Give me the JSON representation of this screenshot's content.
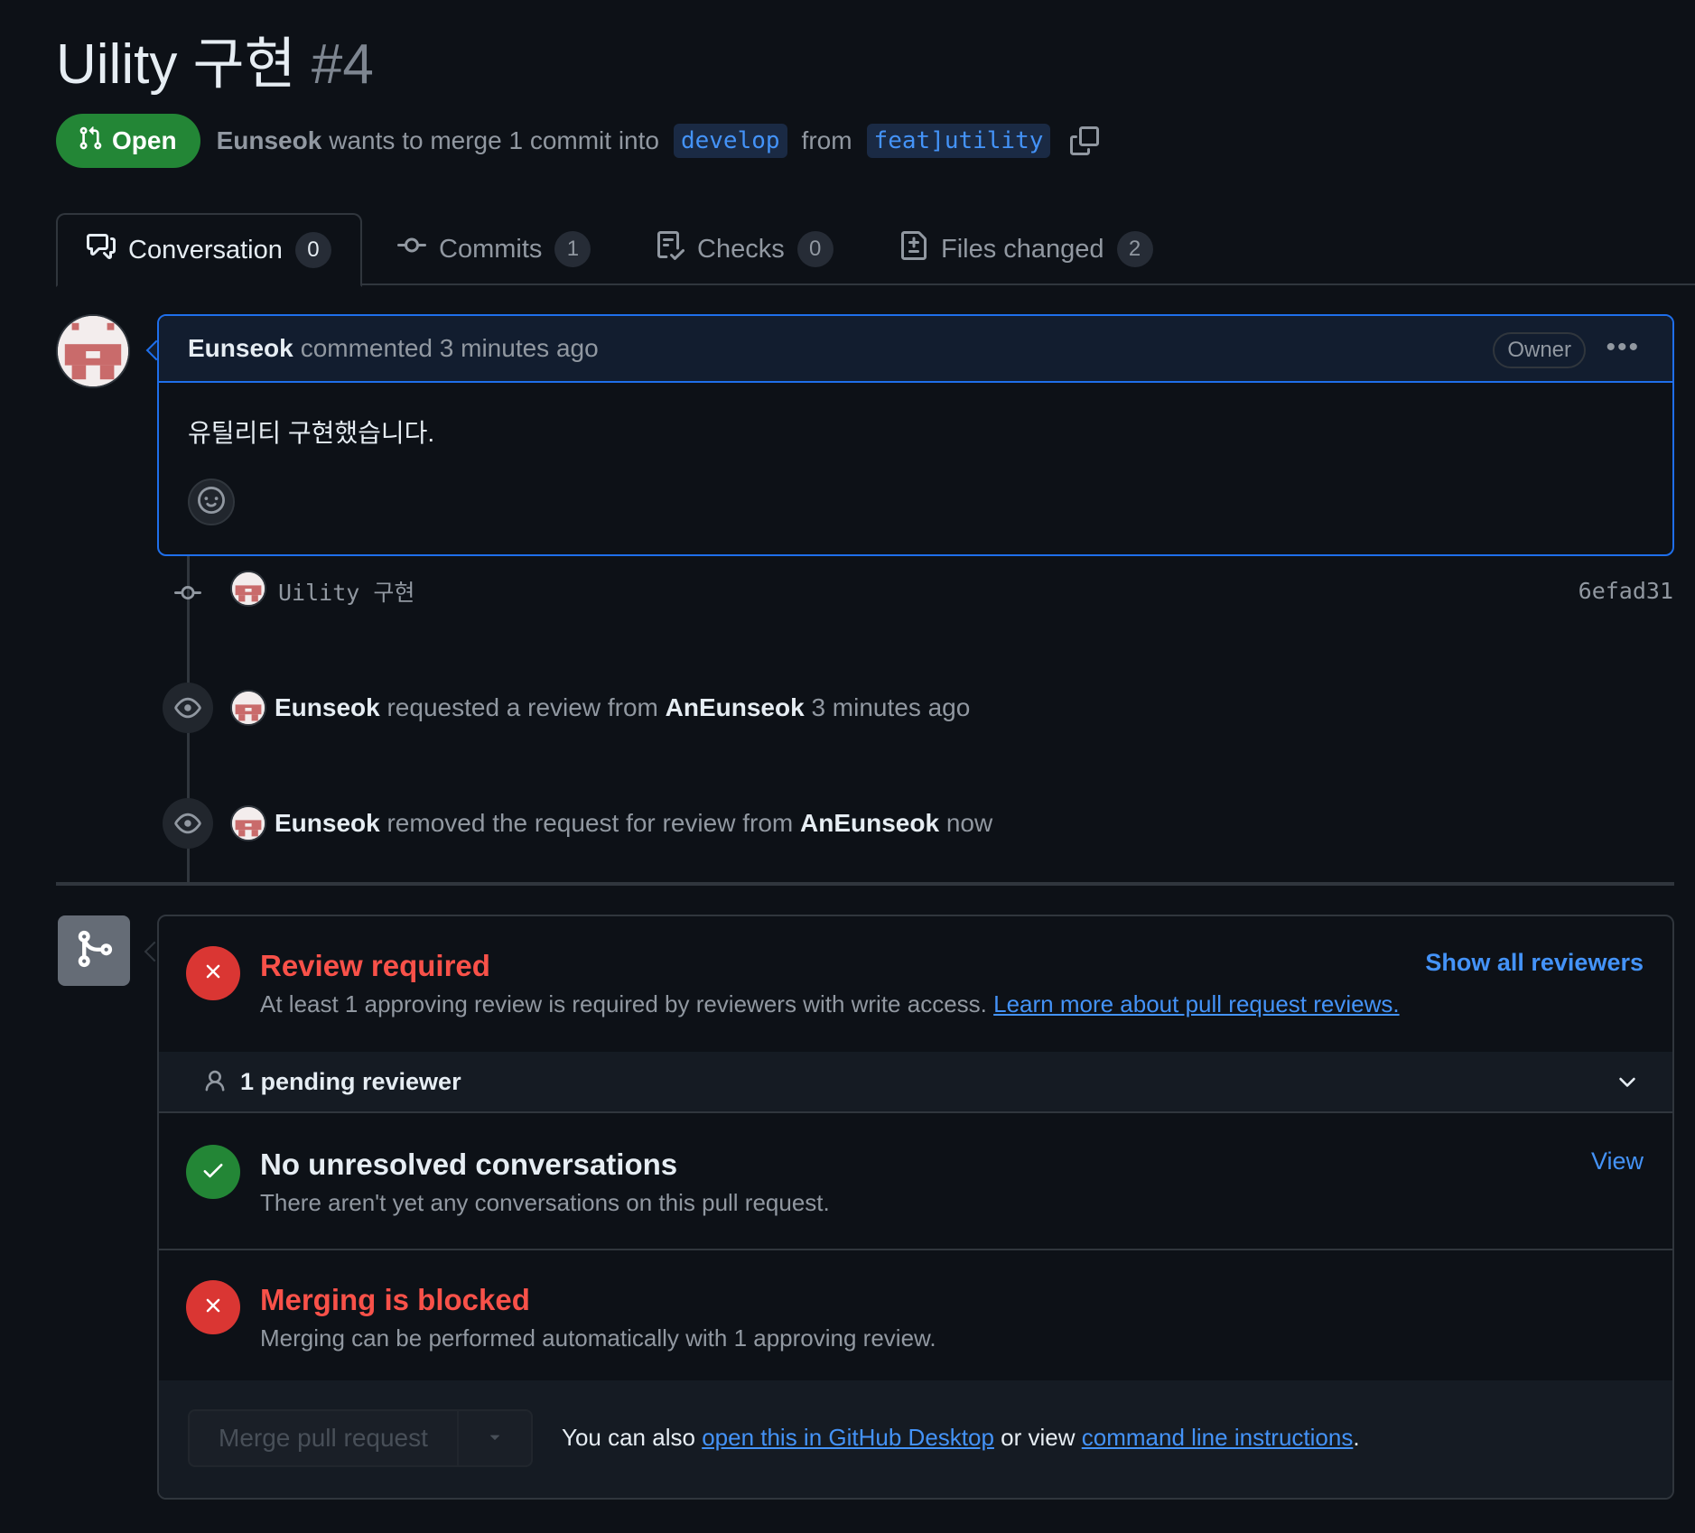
{
  "header": {
    "title": "Uility 구현",
    "number": "#4",
    "state": "Open",
    "author": "Eunseok",
    "merge_text": "wants to merge 1 commit into",
    "base_branch": "develop",
    "from_text": "from",
    "head_branch": "feat]utility"
  },
  "tabs": [
    {
      "label": "Conversation",
      "count": "0"
    },
    {
      "label": "Commits",
      "count": "1"
    },
    {
      "label": "Checks",
      "count": "0"
    },
    {
      "label": "Files changed",
      "count": "2"
    }
  ],
  "comment": {
    "author": "Eunseok",
    "action": "commented 3 minutes ago",
    "badge": "Owner",
    "body": "유틸리티 구현했습니다."
  },
  "timeline": {
    "commit": {
      "message": "Uility 구현",
      "sha": "6efad31"
    },
    "events": [
      {
        "actor": "Eunseok",
        "text": "requested a review from",
        "target": "AnEunseok",
        "time": "3 minutes ago"
      },
      {
        "actor": "Eunseok",
        "text": "removed the request for review from",
        "target": "AnEunseok",
        "time": "now"
      }
    ]
  },
  "merge_box": {
    "review": {
      "title": "Review required",
      "desc": "At least 1 approving review is required by reviewers with write access.",
      "link": "Learn more about pull request reviews.",
      "action": "Show all reviewers"
    },
    "pending": "1 pending reviewer",
    "conversations": {
      "title": "No unresolved conversations",
      "desc": "There aren't yet any conversations on this pull request.",
      "action": "View"
    },
    "blocked": {
      "title": "Merging is blocked",
      "desc": "Merging can be performed automatically with 1 approving review."
    },
    "footer": {
      "button": "Merge pull request",
      "prefix": "You can also",
      "desktop_link": "open this in GitHub Desktop",
      "middle": "or view",
      "cli_link": "command line instructions",
      "suffix": "."
    }
  },
  "colors": {
    "background": "#0d1117",
    "open_green": "#238636",
    "danger_red": "#da3633",
    "link_blue": "#4493f8",
    "border": "#30363d"
  },
  "icons": [
    "git-pull-request-icon",
    "copy-icon",
    "comment-discussion-icon",
    "git-commit-icon",
    "checklist-icon",
    "file-diff-icon",
    "kebab-horizontal-icon",
    "smiley-icon",
    "eye-icon",
    "git-merge-icon",
    "x-icon",
    "check-icon",
    "person-icon",
    "chevron-down-icon",
    "triangle-down-icon"
  ]
}
